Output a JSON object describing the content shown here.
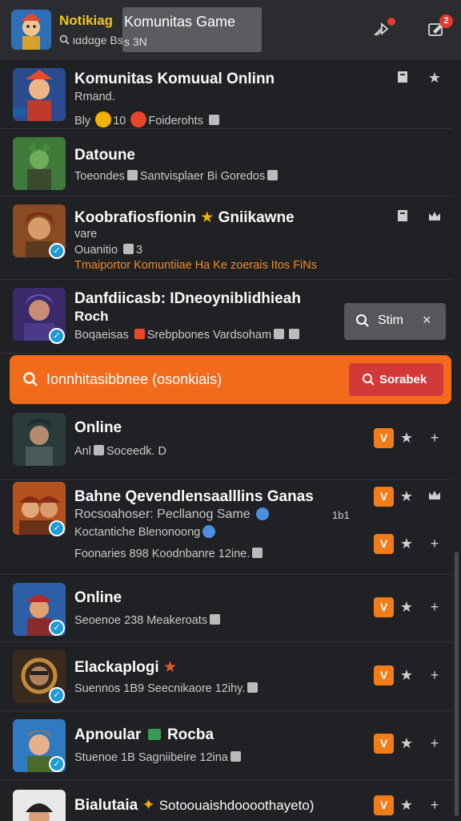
{
  "header": {
    "title": "Notikiag",
    "subtitle": "ιαdαge Bs 3N",
    "chip_label": "Komunitas Game",
    "chip_sub": "s 3N",
    "badge_left": "",
    "badge_right": "2"
  },
  "popup": {
    "label": "Stim",
    "close": "×"
  },
  "searchbar": {
    "text": "Ionnhitasibbnee (osonkiais)",
    "button": "Sorabek"
  },
  "rows": [
    {
      "title": "Komunitas Komuual Onlinn",
      "lines": [
        "Rmand.",
        "Bly",
        "10",
        "Foiderohts"
      ]
    },
    {
      "title": "Datoune",
      "lines": [
        "Toeondes",
        "Santvisplaer Bi Goredos"
      ]
    },
    {
      "title": "Koobrafiosfionin",
      "title_b": "Gniikawne",
      "lines": [
        "vare",
        "Ouanitio",
        "3",
        "Tmaiportor Komuntiiae Ha Ke zoerais Itos FiNs"
      ]
    },
    {
      "title": "Danfdiicasb: IDneoyniblidhieah",
      "title_b": "Roch",
      "lines": [
        "Boqaeisas",
        "Srebpbones Vardsoham"
      ]
    },
    {
      "title": "Online",
      "lines": [
        "Anl",
        "Soceedk. D"
      ]
    },
    {
      "title": "Bahne Qevendlensaalllins Ganas",
      "lines": [
        "Rocsoahoser: Pecllanog Same",
        "1b1",
        "Koctantiche Blenonoong",
        "Foonaries 898 Koodnbanre 12ine."
      ]
    },
    {
      "title": "Online",
      "lines": [
        "Seoenoe 238 Meakeroats"
      ]
    },
    {
      "title": "Elackaplogi",
      "lines": [
        "Suennos 1B9 Seecnikaore 12ihy."
      ]
    },
    {
      "title": "Apnoular",
      "title_b": "Rocba",
      "lines": [
        "Stuenoe 1B Sagniibeire 12ina"
      ]
    },
    {
      "title": "Bialutaia",
      "title_b": "Sotoouaishdoooothayeto)"
    }
  ],
  "colors": {
    "accent": "#f26a1b",
    "button_red": "#d4393a",
    "bg": "#202124",
    "verified": "#1e9ad6",
    "title_yellow": "#f5c518"
  },
  "icons": [
    "search-icon",
    "close-icon",
    "share-icon",
    "edit-icon",
    "star-icon",
    "plus-icon",
    "bookmark-icon",
    "crown-icon",
    "verified-icon"
  ]
}
